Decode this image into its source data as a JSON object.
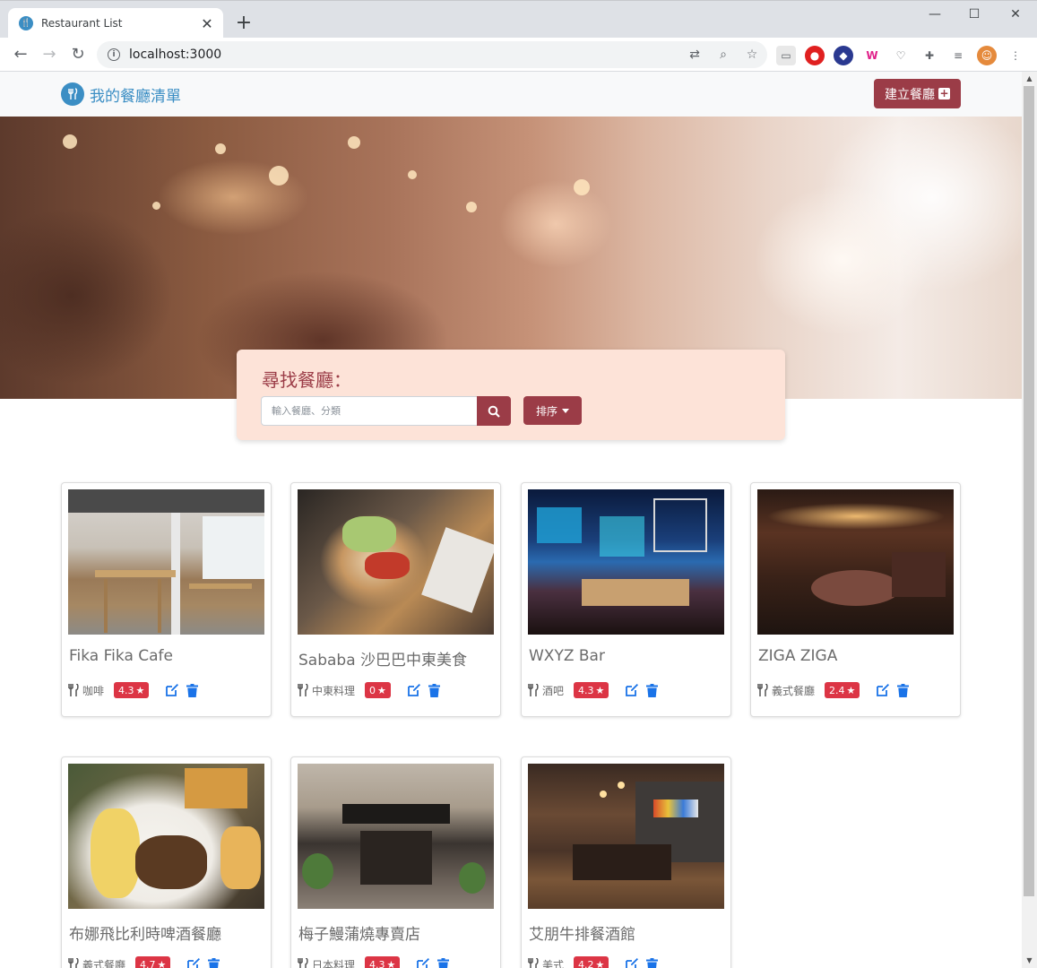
{
  "browser": {
    "tab_title": "Restaurant List",
    "url": "localhost:3000"
  },
  "navbar": {
    "brand": "我的餐廳清單",
    "create_label": "建立餐廳"
  },
  "search": {
    "title": "尋找餐廳：",
    "placeholder": "輸入餐廳、分類",
    "sort_label": "排序"
  },
  "colors": {
    "brand": "#3b8ec4",
    "accent": "#9b3c47",
    "panel": "#fde3d8",
    "badge": "#dc3545",
    "action": "#1a73e8"
  },
  "restaurants": [
    {
      "name": "Fika Fika Cafe",
      "category": "咖啡",
      "rating": "4.3"
    },
    {
      "name": "Sababa 沙巴巴中東美食",
      "category": "中東料理",
      "rating": "0"
    },
    {
      "name": "WXYZ Bar",
      "category": "酒吧",
      "rating": "4.3"
    },
    {
      "name": "ZIGA ZIGA",
      "category": "義式餐廳",
      "rating": "2.4"
    },
    {
      "name": "布娜飛比利時啤酒餐廳",
      "category": "義式餐廳",
      "rating": "4.7"
    },
    {
      "name": "梅子鰻蒲燒專賣店",
      "category": "日本料理",
      "rating": "4.3"
    },
    {
      "name": "艾朋牛排餐酒館",
      "category": "美式",
      "rating": "4.2"
    }
  ]
}
